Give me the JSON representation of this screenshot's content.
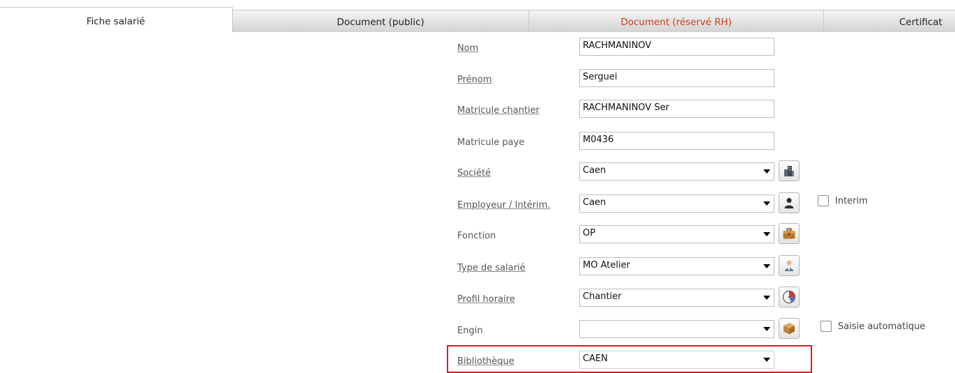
{
  "tabs": [
    {
      "label": "Fiche salarié",
      "active": true
    },
    {
      "label": "Document (public)"
    },
    {
      "label": "Document (réservé RH)",
      "accent_color": "#c8401c"
    },
    {
      "label": "Certificat"
    }
  ],
  "form": {
    "nom": {
      "label": "Nom",
      "value": "RACHMANINOV"
    },
    "prenom": {
      "label": "Prénom",
      "value": "Serguei"
    },
    "matricule_chantier": {
      "label": "Matricule chantier",
      "value": "RACHMANINOV Ser"
    },
    "matricule_paye": {
      "label": "Matricule paye",
      "value": "M0436"
    },
    "societe": {
      "label": "Société",
      "value": "Caen",
      "icon": "building-icon"
    },
    "employeur": {
      "label": "Employeur / Intérim.",
      "value": "Caen",
      "icon": "person-icon",
      "checkbox_label": "Interim",
      "checked": false
    },
    "fonction": {
      "label": "Fonction",
      "value": "OP",
      "icon": "briefcase-icon"
    },
    "type_salarie": {
      "label": "Type de salarié",
      "value": "MO Atelier",
      "icon": "worker-icon"
    },
    "profil_horaire": {
      "label": "Profil horaire",
      "value": "Chantier",
      "icon": "pie-clock-icon"
    },
    "engin": {
      "label": "Engin",
      "value": "",
      "icon": "box-icon",
      "checkbox_label": "Saisie automatique",
      "checked": false
    },
    "bibliotheque": {
      "label": "Bibliothèque",
      "value": "CAEN"
    }
  },
  "colors": {
    "highlight": "#e0191e",
    "accent": "#c8401c"
  }
}
